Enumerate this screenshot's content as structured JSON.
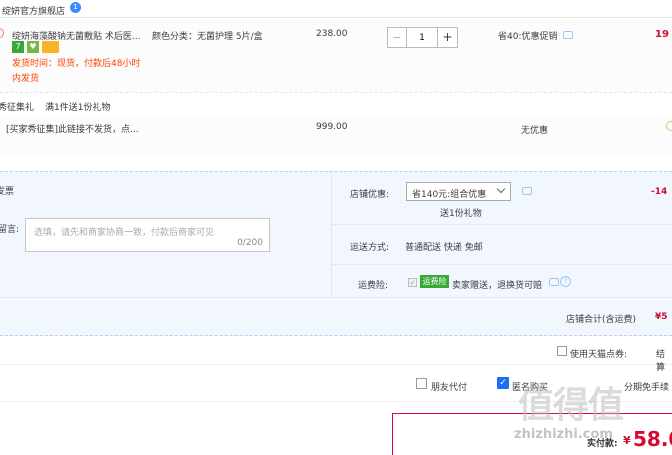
{
  "shop": {
    "name": "绽妍官方旗舰店",
    "badge": "1"
  },
  "item1": {
    "title": "绽妍海藻酸钠无菌敷贴 术后医...",
    "sku": "颜色分类：无菌护理 5片/盒",
    "ship_time": "发货时间：现货，付款后48小时",
    "ship_time2": "内发货",
    "price": "238.00",
    "qty": "1",
    "minus": "−",
    "plus": "+",
    "promo": "省40:优惠促销",
    "total": "19"
  },
  "gift": {
    "label": "秀征集礼",
    "desc": "满1件送1份礼物"
  },
  "item2": {
    "title": "[买家秀征集]此链接不发货，点...",
    "price": "999.00",
    "promo": "无优惠"
  },
  "order": {
    "invoice_label": "发票",
    "message_label": "留言:",
    "message_placeholder": "选填，请先和商家协商一致，付款后商家可见",
    "message_count": "0/200",
    "shop_discount_label": "店铺优惠:",
    "shop_discount_value": "省140元:组合优惠",
    "gift_note": "送1份礼物",
    "discount_amount": "-14",
    "delivery_label": "运送方式:",
    "delivery_value": "普通配送 快递 免邮",
    "insurance_label": "运费险:",
    "insurance_tag": "运费险",
    "insurance_desc": "卖家赠送，退换货可赔",
    "shop_total_label": "店铺合计(含运费)",
    "shop_total_value": "¥5"
  },
  "points": {
    "label": "使用天猫点券:",
    "right": "结算"
  },
  "options": {
    "friend_pay": "朋友代付",
    "anon_buy": "匿名购买",
    "right_hint": "分期免手续"
  },
  "final": {
    "label": "实付款:",
    "currency": "¥",
    "amount": "58.0"
  },
  "watermark": {
    "text1": "值得值",
    "text2": "zhizhizhi.com"
  },
  "colors": {
    "accent": "#ff5000",
    "price_red": "#d40a2e",
    "panel_bg": "#f2f7ff",
    "panel_border": "#b2d1ff"
  }
}
